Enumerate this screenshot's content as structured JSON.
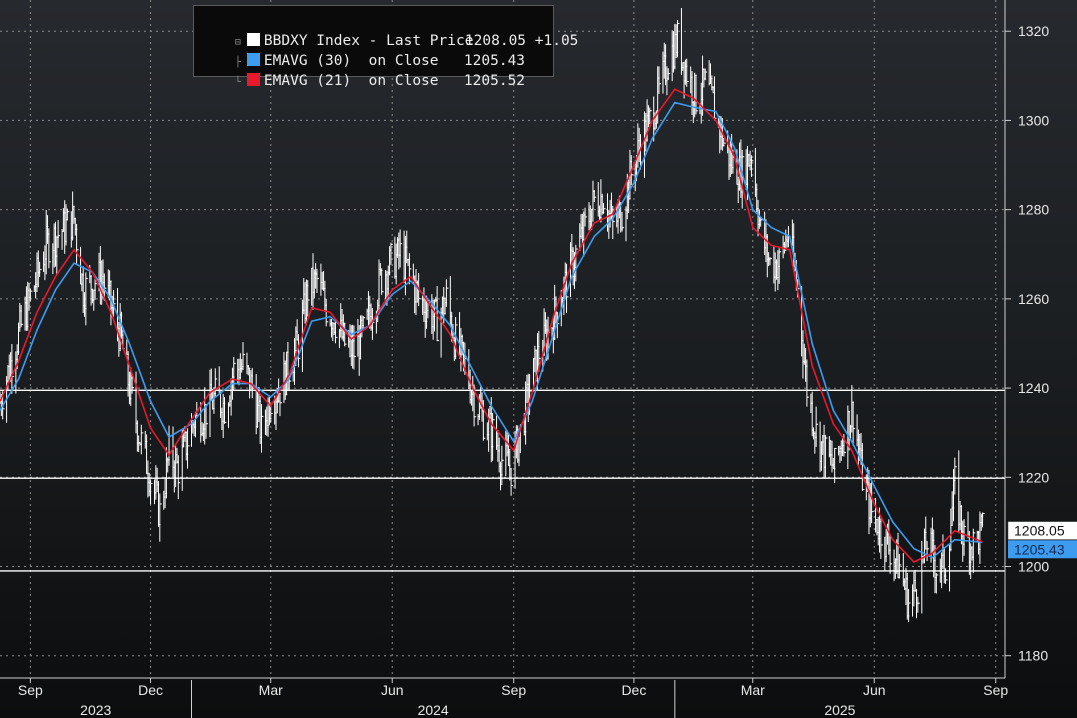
{
  "chart_data": {
    "type": "line",
    "title": "",
    "xlabel": "",
    "ylabel": "",
    "ylim": [
      1175,
      1327
    ],
    "xlim": [
      "2023-08-09",
      "2025-09-08"
    ],
    "y_ticks": [
      1180,
      1200,
      1220,
      1240,
      1260,
      1280,
      1300,
      1320
    ],
    "x_ticks": [
      {
        "date": "2023-09-01",
        "label": "Sep"
      },
      {
        "date": "2023-12-01",
        "label": "Dec"
      },
      {
        "date": "2024-03-01",
        "label": "Mar"
      },
      {
        "date": "2024-06-01",
        "label": "Jun"
      },
      {
        "date": "2024-09-01",
        "label": "Sep"
      },
      {
        "date": "2024-12-01",
        "label": "Dec"
      },
      {
        "date": "2025-03-01",
        "label": "Mar"
      },
      {
        "date": "2025-06-01",
        "label": "Jun"
      },
      {
        "date": "2025-09-01",
        "label": "Sep"
      }
    ],
    "year_labels": [
      {
        "label": "2023",
        "from": "2023-08-09",
        "to": "2024-01-01"
      },
      {
        "label": "2024",
        "from": "2024-01-01",
        "to": "2025-01-01"
      },
      {
        "label": "2025",
        "from": "2025-01-01",
        "to": "2025-09-08"
      }
    ],
    "horizontal_lines": [
      1239.5,
      1219.8,
      1199
    ],
    "grid": true,
    "legend_position": "top-left",
    "series": [
      {
        "name": "BBDXY Index - Last Price",
        "color": "#ffffff",
        "style": "high-low bars",
        "points": [
          [
            "2023-08-09",
            1237
          ],
          [
            "2023-08-23",
            1252
          ],
          [
            "2023-09-06",
            1265
          ],
          [
            "2023-09-13",
            1272
          ],
          [
            "2023-09-27",
            1276
          ],
          [
            "2023-10-04",
            1278
          ],
          [
            "2023-10-11",
            1262
          ],
          [
            "2023-10-25",
            1265
          ],
          [
            "2023-11-08",
            1252
          ],
          [
            "2023-11-15",
            1240
          ],
          [
            "2023-11-22",
            1230
          ],
          [
            "2023-12-01",
            1220
          ],
          [
            "2023-12-08",
            1212
          ],
          [
            "2023-12-15",
            1225
          ],
          [
            "2023-12-22",
            1222
          ],
          [
            "2024-01-03",
            1233
          ],
          [
            "2024-01-12",
            1235
          ],
          [
            "2024-01-19",
            1238
          ],
          [
            "2024-01-26",
            1236
          ],
          [
            "2024-02-02",
            1244
          ],
          [
            "2024-02-09",
            1245
          ],
          [
            "2024-02-16",
            1240
          ],
          [
            "2024-02-23",
            1230
          ],
          [
            "2024-03-01",
            1238
          ],
          [
            "2024-03-08",
            1240
          ],
          [
            "2024-03-15",
            1245
          ],
          [
            "2024-03-22",
            1250
          ],
          [
            "2024-03-29",
            1262
          ],
          [
            "2024-04-05",
            1264
          ],
          [
            "2024-04-12",
            1258
          ],
          [
            "2024-04-19",
            1255
          ],
          [
            "2024-04-26",
            1250
          ],
          [
            "2024-05-03",
            1248
          ],
          [
            "2024-05-10",
            1252
          ],
          [
            "2024-05-17",
            1258
          ],
          [
            "2024-05-24",
            1265
          ],
          [
            "2024-05-31",
            1268
          ],
          [
            "2024-06-07",
            1270
          ],
          [
            "2024-06-14",
            1266
          ],
          [
            "2024-06-21",
            1260
          ],
          [
            "2024-06-28",
            1258
          ],
          [
            "2024-07-05",
            1255
          ],
          [
            "2024-07-12",
            1260
          ],
          [
            "2024-07-19",
            1250
          ],
          [
            "2024-07-26",
            1245
          ],
          [
            "2024-08-02",
            1238
          ],
          [
            "2024-08-09",
            1233
          ],
          [
            "2024-08-16",
            1230
          ],
          [
            "2024-08-23",
            1224
          ],
          [
            "2024-08-30",
            1222
          ],
          [
            "2024-09-06",
            1230
          ],
          [
            "2024-09-13",
            1240
          ],
          [
            "2024-09-20",
            1248
          ],
          [
            "2024-09-27",
            1252
          ],
          [
            "2024-10-04",
            1258
          ],
          [
            "2024-10-11",
            1264
          ],
          [
            "2024-10-18",
            1270
          ],
          [
            "2024-10-25",
            1276
          ],
          [
            "2024-11-01",
            1282
          ],
          [
            "2024-11-08",
            1283
          ],
          [
            "2024-11-15",
            1276
          ],
          [
            "2024-11-22",
            1280
          ],
          [
            "2024-11-29",
            1288
          ],
          [
            "2024-12-06",
            1295
          ],
          [
            "2024-12-13",
            1300
          ],
          [
            "2024-12-20",
            1306
          ],
          [
            "2024-12-27",
            1314
          ],
          [
            "2025-01-03",
            1318
          ],
          [
            "2025-01-10",
            1311
          ],
          [
            "2025-01-17",
            1305
          ],
          [
            "2025-01-24",
            1308
          ],
          [
            "2025-01-31",
            1303
          ],
          [
            "2025-02-07",
            1295
          ],
          [
            "2025-02-14",
            1290
          ],
          [
            "2025-02-21",
            1288
          ],
          [
            "2025-02-28",
            1293
          ],
          [
            "2025-03-07",
            1275
          ],
          [
            "2025-03-14",
            1268
          ],
          [
            "2025-03-21",
            1268
          ],
          [
            "2025-03-28",
            1275
          ],
          [
            "2025-04-04",
            1262
          ],
          [
            "2025-04-11",
            1240
          ],
          [
            "2025-04-18",
            1230
          ],
          [
            "2025-04-25",
            1225
          ],
          [
            "2025-05-02",
            1222
          ],
          [
            "2025-05-09",
            1230
          ],
          [
            "2025-05-16",
            1235
          ],
          [
            "2025-05-23",
            1220
          ],
          [
            "2025-05-30",
            1212
          ],
          [
            "2025-06-06",
            1208
          ],
          [
            "2025-06-13",
            1204
          ],
          [
            "2025-06-20",
            1200
          ],
          [
            "2025-06-27",
            1192
          ],
          [
            "2025-07-04",
            1196
          ],
          [
            "2025-07-11",
            1206
          ],
          [
            "2025-07-18",
            1200
          ],
          [
            "2025-07-25",
            1200
          ],
          [
            "2025-08-01",
            1218
          ],
          [
            "2025-08-08",
            1206
          ],
          [
            "2025-08-15",
            1205
          ],
          [
            "2025-08-22",
            1208.05
          ]
        ]
      },
      {
        "name": "EMAVG (30)  on Close",
        "color": "#3d9bf0",
        "points": [
          [
            "2023-08-09",
            1235
          ],
          [
            "2023-08-23",
            1242
          ],
          [
            "2023-09-06",
            1253
          ],
          [
            "2023-09-20",
            1262
          ],
          [
            "2023-10-04",
            1268
          ],
          [
            "2023-10-18",
            1266
          ],
          [
            "2023-11-01",
            1260
          ],
          [
            "2023-11-15",
            1250
          ],
          [
            "2023-12-01",
            1237
          ],
          [
            "2023-12-15",
            1229
          ],
          [
            "2024-01-01",
            1232
          ],
          [
            "2024-01-15",
            1237
          ],
          [
            "2024-02-01",
            1241
          ],
          [
            "2024-02-15",
            1241
          ],
          [
            "2024-03-01",
            1238
          ],
          [
            "2024-03-15",
            1242
          ],
          [
            "2024-04-01",
            1255
          ],
          [
            "2024-04-15",
            1256
          ],
          [
            "2024-05-01",
            1252
          ],
          [
            "2024-05-15",
            1254
          ],
          [
            "2024-06-01",
            1261
          ],
          [
            "2024-06-15",
            1264
          ],
          [
            "2024-07-01",
            1259
          ],
          [
            "2024-07-15",
            1254
          ],
          [
            "2024-08-01",
            1244
          ],
          [
            "2024-08-15",
            1236
          ],
          [
            "2024-09-01",
            1228
          ],
          [
            "2024-09-15",
            1237
          ],
          [
            "2024-10-01",
            1252
          ],
          [
            "2024-10-15",
            1265
          ],
          [
            "2024-11-01",
            1274
          ],
          [
            "2024-11-15",
            1278
          ],
          [
            "2024-12-01",
            1286
          ],
          [
            "2024-12-15",
            1296
          ],
          [
            "2025-01-01",
            1304
          ],
          [
            "2025-01-15",
            1303
          ],
          [
            "2025-02-01",
            1302
          ],
          [
            "2025-02-15",
            1294
          ],
          [
            "2025-03-01",
            1280
          ],
          [
            "2025-03-15",
            1276
          ],
          [
            "2025-03-29",
            1274
          ],
          [
            "2025-04-15",
            1250
          ],
          [
            "2025-05-01",
            1235
          ],
          [
            "2025-05-15",
            1228
          ],
          [
            "2025-06-01",
            1218
          ],
          [
            "2025-06-15",
            1210
          ],
          [
            "2025-07-01",
            1204
          ],
          [
            "2025-07-15",
            1202
          ],
          [
            "2025-08-01",
            1206
          ],
          [
            "2025-08-22",
            1205.43
          ]
        ]
      },
      {
        "name": "EMAVG (21)  on Close",
        "color": "#e8192c",
        "points": [
          [
            "2023-08-09",
            1237
          ],
          [
            "2023-08-23",
            1246
          ],
          [
            "2023-09-06",
            1257
          ],
          [
            "2023-09-20",
            1265
          ],
          [
            "2023-10-04",
            1271
          ],
          [
            "2023-10-18",
            1266
          ],
          [
            "2023-11-01",
            1257
          ],
          [
            "2023-11-15",
            1245
          ],
          [
            "2023-12-01",
            1231
          ],
          [
            "2023-12-15",
            1225
          ],
          [
            "2024-01-01",
            1233
          ],
          [
            "2024-01-15",
            1239
          ],
          [
            "2024-02-01",
            1242
          ],
          [
            "2024-02-15",
            1241
          ],
          [
            "2024-03-01",
            1236
          ],
          [
            "2024-03-15",
            1243
          ],
          [
            "2024-04-01",
            1258
          ],
          [
            "2024-04-15",
            1257
          ],
          [
            "2024-05-01",
            1251
          ],
          [
            "2024-05-15",
            1254
          ],
          [
            "2024-06-01",
            1262
          ],
          [
            "2024-06-15",
            1265
          ],
          [
            "2024-07-01",
            1258
          ],
          [
            "2024-07-15",
            1252
          ],
          [
            "2024-08-01",
            1240
          ],
          [
            "2024-08-15",
            1232
          ],
          [
            "2024-09-01",
            1226
          ],
          [
            "2024-09-15",
            1239
          ],
          [
            "2024-10-01",
            1256
          ],
          [
            "2024-10-15",
            1268
          ],
          [
            "2024-11-01",
            1277
          ],
          [
            "2024-11-15",
            1279
          ],
          [
            "2024-12-01",
            1290
          ],
          [
            "2024-12-15",
            1300
          ],
          [
            "2025-01-01",
            1307
          ],
          [
            "2025-01-15",
            1305
          ],
          [
            "2025-02-01",
            1300
          ],
          [
            "2025-02-15",
            1292
          ],
          [
            "2025-03-01",
            1276
          ],
          [
            "2025-03-15",
            1272
          ],
          [
            "2025-03-29",
            1271
          ],
          [
            "2025-04-15",
            1245
          ],
          [
            "2025-05-01",
            1232
          ],
          [
            "2025-05-15",
            1226
          ],
          [
            "2025-06-01",
            1214
          ],
          [
            "2025-06-15",
            1206
          ],
          [
            "2025-07-01",
            1201
          ],
          [
            "2025-07-15",
            1203
          ],
          [
            "2025-08-01",
            1208
          ],
          [
            "2025-08-22",
            1205.52
          ]
        ]
      }
    ],
    "last_value_labels": [
      {
        "series": "BBDXY Index - Last Price",
        "value": 1208.05,
        "text": "1208.05"
      },
      {
        "series": "EMAVG (30)  on Close",
        "value": 1205.43,
        "text": "1205.43"
      }
    ]
  },
  "legend": {
    "items": [
      {
        "label": "BBDXY Index - Last Price",
        "value": "1208.05",
        "change": "+1.05",
        "color": "#ffffff"
      },
      {
        "label": "EMAVG (30)  on Close",
        "value": "1205.43",
        "color": "#3d9bf0"
      },
      {
        "label": "EMAVG (21)  on Close",
        "value": "1205.52",
        "color": "#e8192c"
      }
    ]
  }
}
